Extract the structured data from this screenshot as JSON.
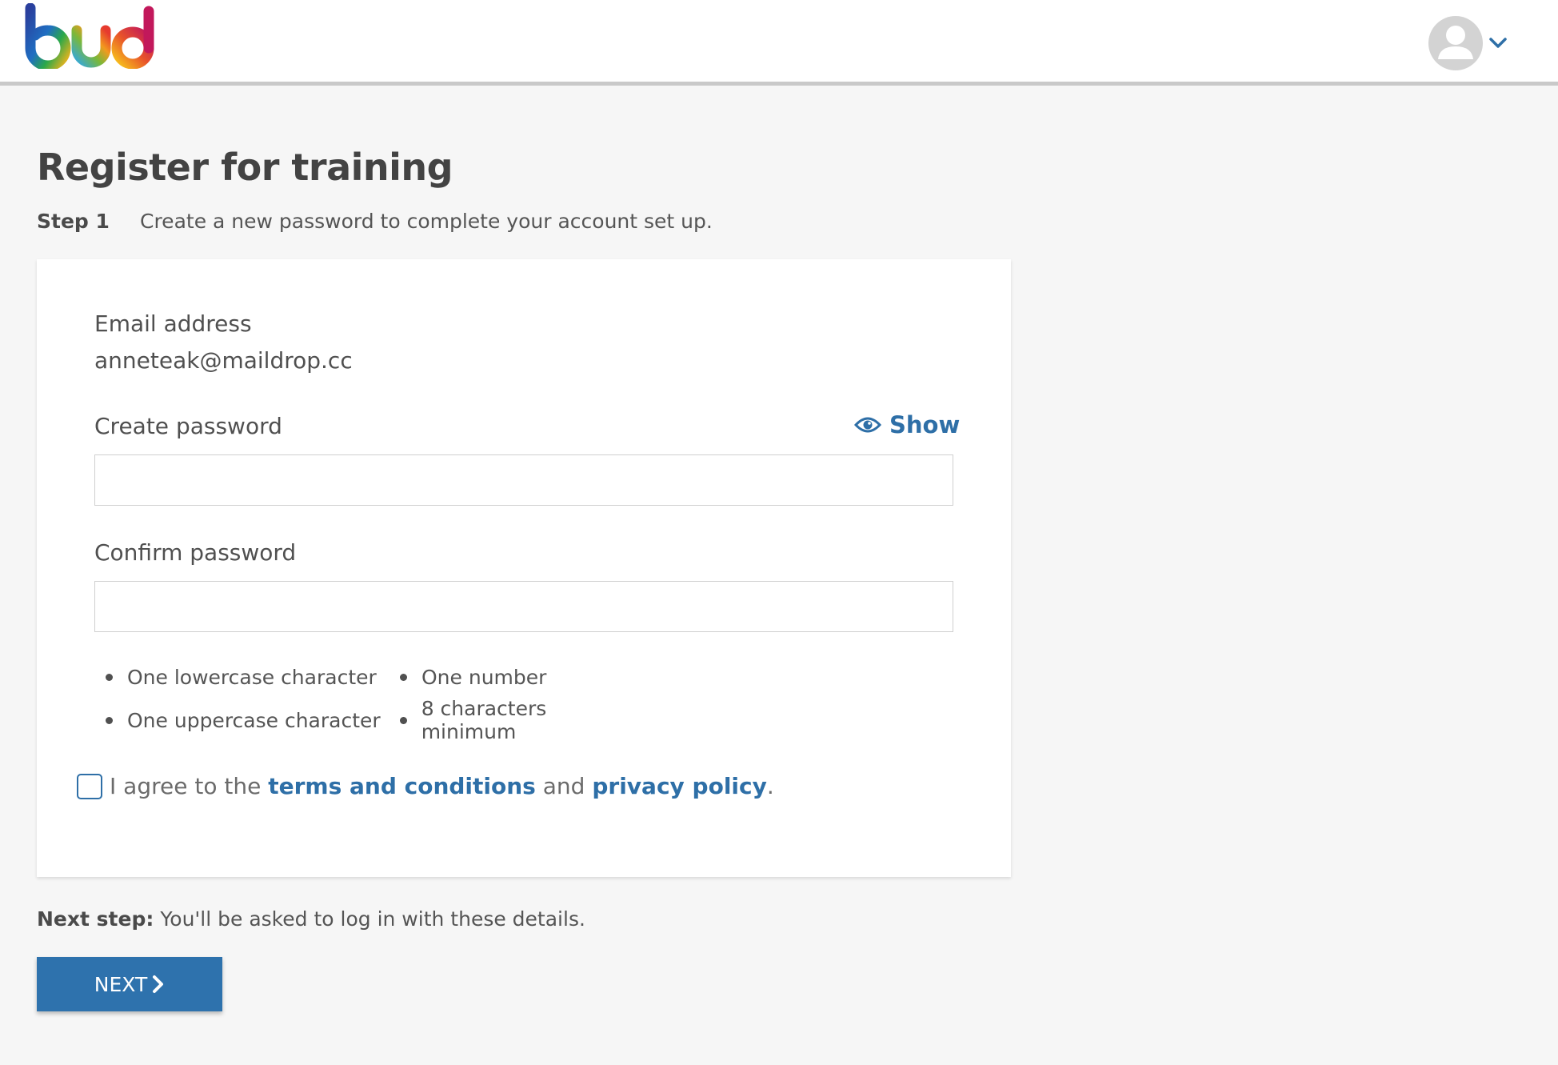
{
  "colors": {
    "accent": "#2e72ad",
    "link": "#2e6fa7",
    "background": "#f6f6f6"
  },
  "header": {
    "logo_text": "bud",
    "avatar_icon": "user-icon",
    "menu_icon": "chevron-down-icon"
  },
  "page": {
    "title": "Register for training",
    "step_label": "Step 1",
    "step_text": "Create a new password to complete your account set up."
  },
  "form": {
    "email_label": "Email address",
    "email_value": "anneteak@maildrop.cc",
    "password_label": "Create password",
    "password_value": "",
    "show_label": "Show",
    "show_icon": "eye-icon",
    "confirm_label": "Confirm password",
    "confirm_value": "",
    "rules": [
      "One lowercase character",
      "One number",
      "One uppercase character",
      "8 characters minimum"
    ],
    "agree": {
      "prefix": "I agree to the",
      "terms_link": "terms and conditions",
      "middle": "and",
      "privacy_link": "privacy policy",
      "suffix": ".",
      "checked": false
    }
  },
  "footer": {
    "next_step_label": "Next step:",
    "next_step_text": "You'll be asked to log in with these details.",
    "next_button_label": "NEXT",
    "next_button_icon": "chevron-right-icon"
  }
}
